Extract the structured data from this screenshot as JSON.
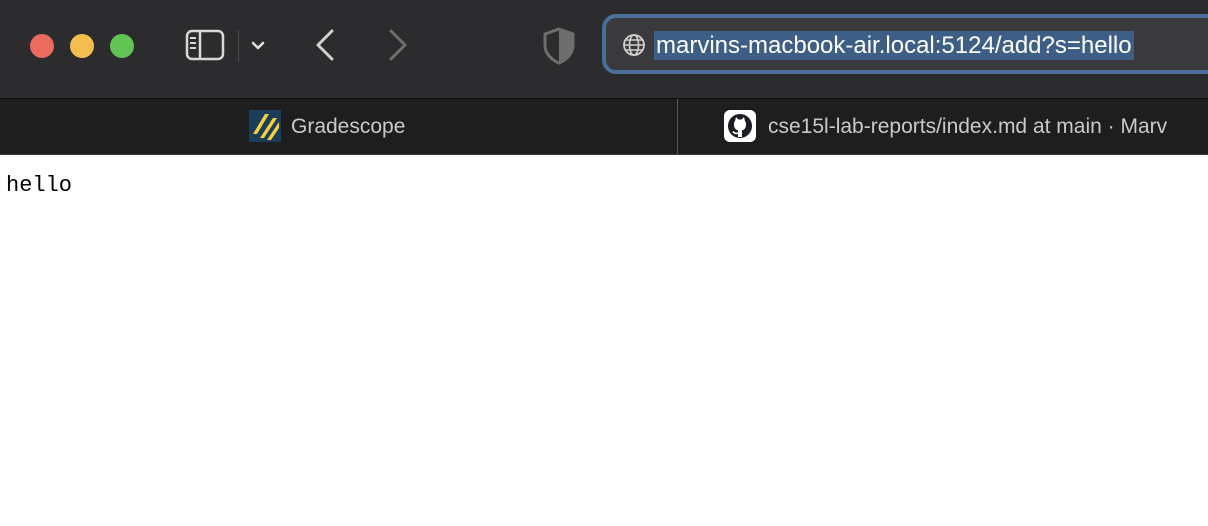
{
  "window": {
    "colors": {
      "close": "#ec6a5e",
      "minimize": "#f4be4f",
      "zoom": "#61c454"
    }
  },
  "toolbar": {
    "icons": [
      "sidebar-icon",
      "chevron-down-icon",
      "back-arrow-icon",
      "forward-arrow-icon",
      "privacy-shield-icon",
      "globe-icon"
    ],
    "address_bar": {
      "url": "marvins-macbook-air.local:5124/add?s=hello",
      "selected": true,
      "selection_color": "#3e5f85"
    }
  },
  "tabs": [
    {
      "label": "Gradescope",
      "icon": "gradescope-icon"
    },
    {
      "label": "cse15l-lab-reports/index.md at main · Marv",
      "icon": "github-icon"
    }
  ],
  "page": {
    "body_text": "hello"
  }
}
